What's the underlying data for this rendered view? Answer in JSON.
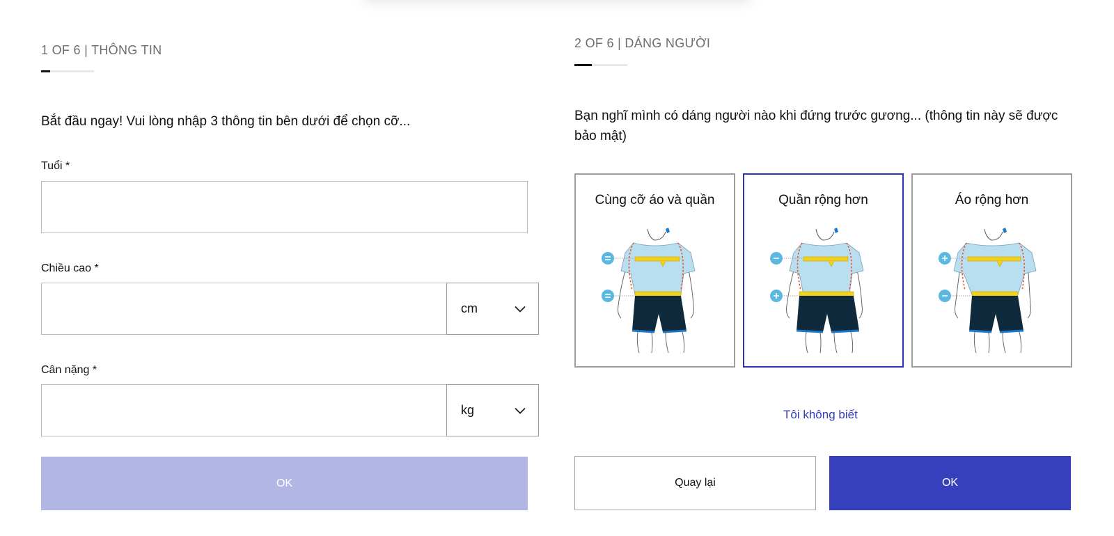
{
  "left": {
    "step_title": "1 OF 6 | THÔNG TIN",
    "progress": 0.17,
    "intro": "Bắt đầu ngay! Vui lòng nhập 3 thông tin bên dưới để chọn cỡ...",
    "age": {
      "label": "Tuổi *",
      "value": ""
    },
    "height": {
      "label": "Chiều cao *",
      "value": "",
      "unit": "cm"
    },
    "weight": {
      "label": "Cân nặng *",
      "value": "",
      "unit": "kg"
    },
    "ok_label": "OK"
  },
  "right": {
    "step_title": "2 OF 6 | DÁNG NGƯỜI",
    "progress": 0.33,
    "intro": "Bạn nghĩ mình có dáng người nào khi đứng trước gương... (thông tin này sẽ được bảo mật)",
    "cards": [
      {
        "label": "Cùng cỡ áo và quần",
        "upper_sign": "=",
        "lower_sign": "=",
        "selected": false
      },
      {
        "label": "Quần rộng hơn",
        "upper_sign": "−",
        "lower_sign": "+",
        "selected": true
      },
      {
        "label": "Áo rộng hơn",
        "upper_sign": "+",
        "lower_sign": "−",
        "selected": false
      }
    ],
    "dont_know_label": "Tôi không biết",
    "back_label": "Quay lại",
    "ok_label": "OK"
  },
  "colors": {
    "primary": "#3640bc",
    "primary_disabled": "#b2b6e5",
    "shirt": "#b9def0",
    "shorts": "#0f2a3c",
    "tape": "#f2d21b",
    "sign": "#5bb8e0",
    "outline_dash": "#e8532a"
  },
  "icons": [
    "chevron-down-icon",
    "body-shape-figure",
    "equal-sign-icon",
    "minus-sign-icon",
    "plus-sign-icon"
  ]
}
